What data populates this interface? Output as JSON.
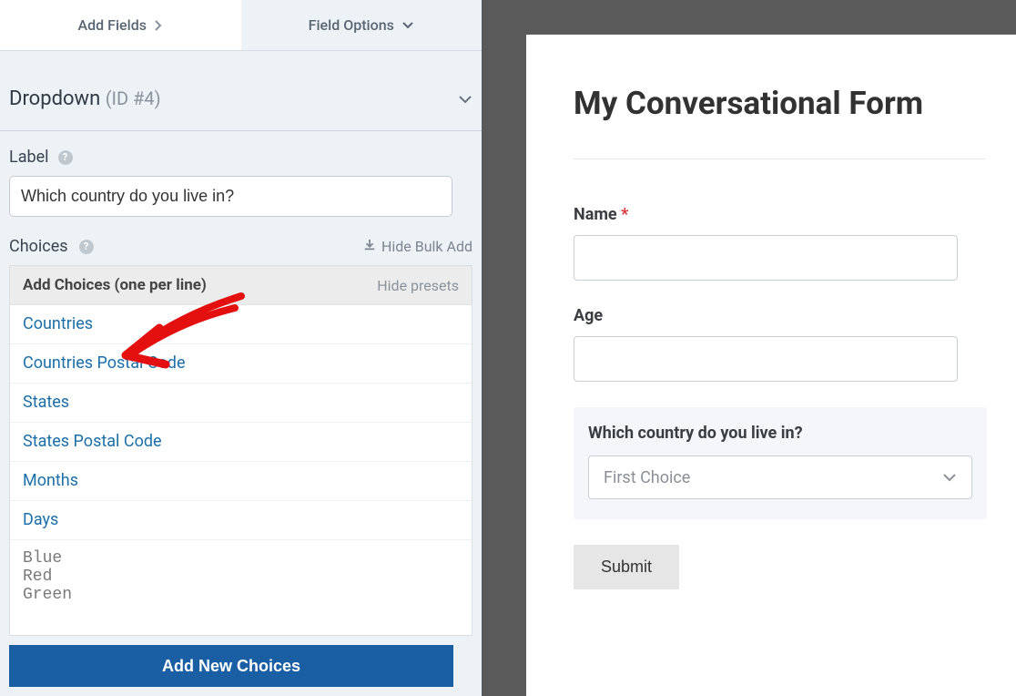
{
  "tabs": {
    "add_fields": "Add Fields",
    "field_options": "Field Options"
  },
  "section": {
    "title": "Dropdown",
    "id": "(ID #4)"
  },
  "label_field": {
    "label": "Label",
    "value": "Which country do you live in?"
  },
  "choices": {
    "label": "Choices",
    "hide_bulk": "Hide Bulk Add",
    "box_title": "Add Choices (one per line)",
    "hide_presets": "Hide presets",
    "presets": [
      "Countries",
      "Countries Postal Code",
      "States",
      "States Postal Code",
      "Months",
      "Days"
    ],
    "textarea_value": "Blue\nRed\nGreen",
    "add_btn": "Add New Choices"
  },
  "preview": {
    "form_title": "My Conversational Form",
    "fields": {
      "name": {
        "label": "Name",
        "required": "*"
      },
      "age": {
        "label": "Age"
      },
      "country": {
        "label": "Which country do you live in?",
        "selected": "First Choice"
      }
    },
    "submit": "Submit"
  }
}
